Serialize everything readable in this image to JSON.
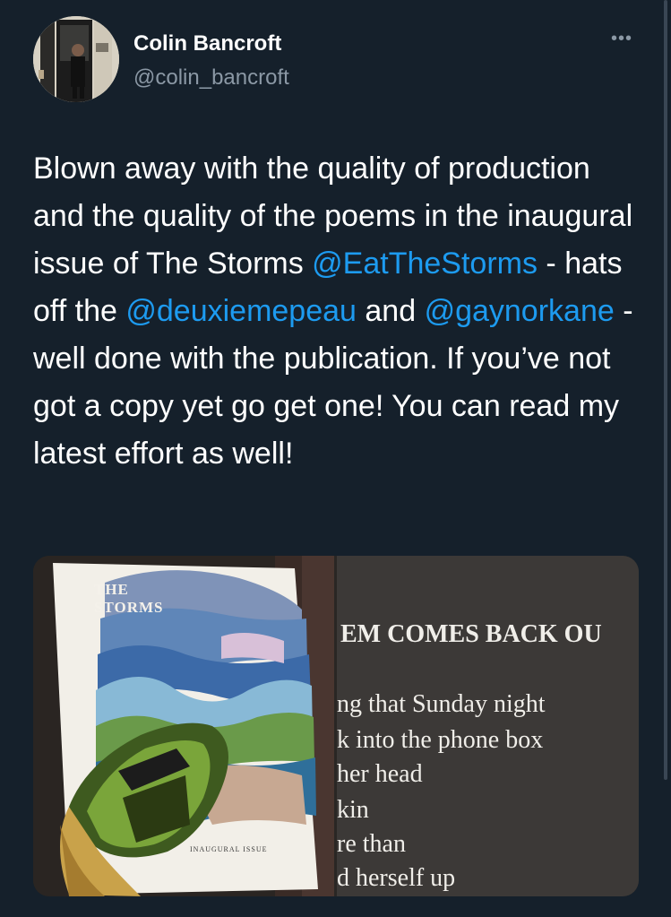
{
  "user": {
    "name": "Colin Bancroft",
    "handle": "@colin_bancroft",
    "more_icon": "more-horizontal-icon"
  },
  "tweet": {
    "part1": "Blown away with the quality of production and the quality of the poems in the inaugural issue of The Storms ",
    "mention1": "@EatTheStorms",
    "part2": " - hats off the ",
    "mention2": "@deuxiemepeau",
    "part3": " and ",
    "mention3": "@gaynorkane",
    "part4": " - well done with the publication. If you’ve not got a copy yet go get one! You can read my latest effort as well!"
  },
  "media": {
    "cover": {
      "title_line1": "THE",
      "title_line2": "STORMS",
      "subtitle": "INAUGURAL ISSUE"
    },
    "page": {
      "title": "EM COMES BACK OU",
      "lines": [
        "ng that Sunday night",
        "k into the phone box",
        "her head",
        "kin",
        "re than",
        "d herself up"
      ]
    }
  },
  "colors": {
    "background": "#15202b",
    "link": "#1d9bf0",
    "secondary_text": "#8b98a5"
  }
}
